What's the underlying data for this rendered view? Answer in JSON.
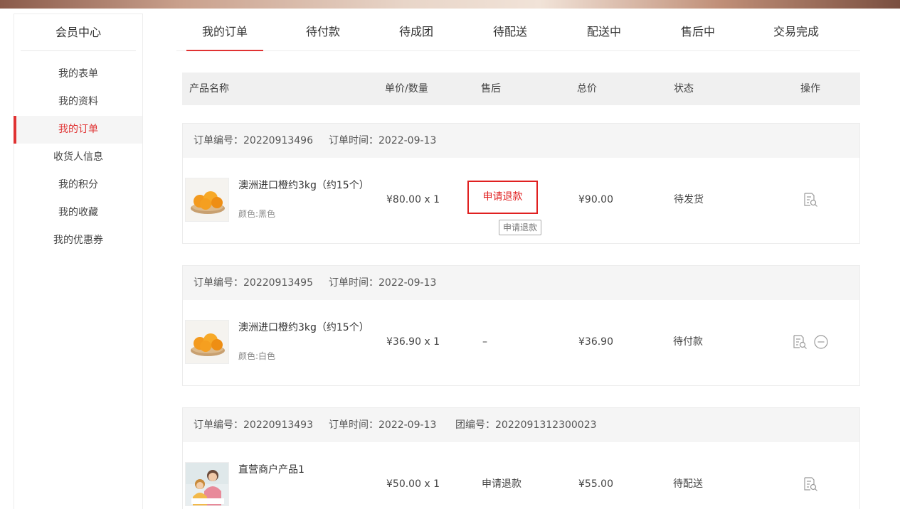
{
  "sidebar": {
    "title": "会员中心",
    "items": [
      {
        "label": "我的表单"
      },
      {
        "label": "我的资料"
      },
      {
        "label": "我的订单"
      },
      {
        "label": "收货人信息"
      },
      {
        "label": "我的积分"
      },
      {
        "label": "我的收藏"
      },
      {
        "label": "我的优惠券"
      }
    ]
  },
  "tabs": [
    {
      "label": "我的订单"
    },
    {
      "label": "待付款"
    },
    {
      "label": "待成团"
    },
    {
      "label": "待配送"
    },
    {
      "label": "配送中"
    },
    {
      "label": "售后中"
    },
    {
      "label": "交易完成"
    }
  ],
  "table_header": {
    "product": "产品名称",
    "price_qty": "单价/数量",
    "after_sale": "售后",
    "total": "总价",
    "status": "状态",
    "ops": "操作"
  },
  "orders": [
    {
      "order_no": "订单编号：20220913496",
      "order_time": "订单时间：2022-09-13",
      "product_name": "澳洲进口橙约3kg（约15个）",
      "attr": "颜色:黑色",
      "price_qty": "¥80.00 x 1",
      "after_sale": "申请退款",
      "after_sale_tooltip": "申请退款",
      "total": "¥90.00",
      "status": "待发货"
    },
    {
      "order_no": "订单编号：20220913495",
      "order_time": "订单时间：2022-09-13",
      "product_name": "澳洲进口橙约3kg（约15个）",
      "attr": "颜色:白色",
      "price_qty": "¥36.90 x 1",
      "after_sale": "–",
      "total": "¥36.90",
      "status": "待付款"
    },
    {
      "order_no": "订单编号：20220913493",
      "order_time": "订单时间：2022-09-13",
      "group_no": "团编号：2022091312300023",
      "product_name": "直营商户产品1",
      "price_qty": "¥50.00 x 1",
      "after_sale": "申请退款",
      "total": "¥55.00",
      "status": "待配送"
    }
  ],
  "icons": {
    "view": "order-detail-icon",
    "cancel": "cancel-order-icon"
  },
  "colors": {
    "accent": "#e03232",
    "header_bg": "#f0f0f0"
  }
}
